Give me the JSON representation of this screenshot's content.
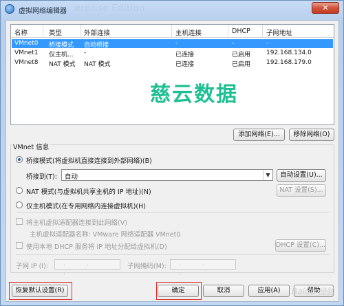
{
  "window": {
    "title": "虚拟网络编辑器",
    "title_watermark": "erprise Edition",
    "close_label": "✕"
  },
  "table": {
    "columns": [
      "名称",
      "类型",
      "外部连接",
      "主机连接",
      "DHCP",
      "子网地址"
    ],
    "rows": [
      {
        "name": "VMnet0",
        "type": "桥接模式",
        "external": "自动桥接",
        "host": "-",
        "dhcp": "-",
        "subnet": "-",
        "selected": true
      },
      {
        "name": "VMnet1",
        "type": "仅主机...",
        "external": "-",
        "host": "已连接",
        "dhcp": "已启用",
        "subnet": "192.168.134.0",
        "selected": false
      },
      {
        "name": "VMnet8",
        "type": "NAT 模式",
        "external": "NAT 模式",
        "host": "已连接",
        "dhcp": "已启用",
        "subnet": "192.168.179.0",
        "selected": false
      }
    ]
  },
  "watermark": "慈云数据",
  "buttons": {
    "add_network": "添加网络(E)...",
    "remove_network": "移除网络(O)",
    "auto_settings": "自动设置(U)...",
    "nat_settings": "NAT 设置(S)...",
    "dhcp_settings": "DHCP 设置(C)...",
    "restore_defaults": "恢复默认设置(R)",
    "ok": "确定",
    "cancel": "取消",
    "apply": "应用(A)",
    "help": "帮助"
  },
  "vmnet_info": {
    "group_title": "VMnet 信息",
    "bridged_label": "桥接模式(将虚拟机直接连接到外部网络)(B)",
    "bridged_to_label": "桥接到(T):",
    "bridged_to_value": "自动",
    "nat_label": "NAT 模式(与虚拟机共享主机的 IP 地址)(N)",
    "hostonly_label": "仅主机模式(在专用网络内连接虚拟机)(H)",
    "connect_adapter_label": "将主机虚拟适配器连接到此网络(V)",
    "adapter_name_label": "主机虚拟适配器名称: VMware 网络适配器 VMnet0",
    "use_dhcp_label": "使用本地 DHCP 服务将 IP 地址分配给虚拟机(D)",
    "subnet_ip_label": "子网 IP (I):",
    "subnet_mask_label": "子网掩码(M):",
    "ip_placeholder": ". . .",
    "mask_placeholder": ". . ."
  },
  "corner_watermark": "Baidu 经验"
}
